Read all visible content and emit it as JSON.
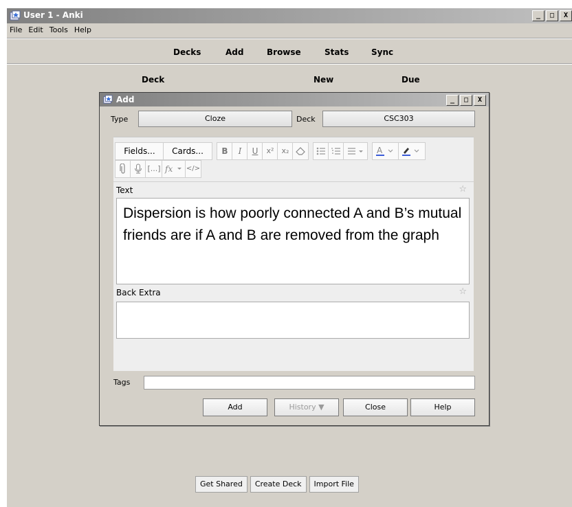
{
  "main_window": {
    "title": "User 1 - Anki",
    "menu": [
      "File",
      "Edit",
      "Tools",
      "Help"
    ],
    "toolbar": [
      "Decks",
      "Add",
      "Browse",
      "Stats",
      "Sync"
    ],
    "deck_header": {
      "deck": "Deck",
      "new": "New",
      "due": "Due"
    },
    "bottom_buttons": [
      "Get Shared",
      "Create Deck",
      "Import File"
    ],
    "window_buttons": {
      "minimize": "_",
      "maximize": "□",
      "close": "X"
    }
  },
  "add_dialog": {
    "title": "Add",
    "type_label": "Type",
    "type_value": "Cloze",
    "deck_label": "Deck",
    "deck_value": "CSC303",
    "editor_toolbar": {
      "fields": "Fields...",
      "cards": "Cards...",
      "bold": "B",
      "italic": "I",
      "underline": "U",
      "superscript": "x²",
      "subscript": "x₂",
      "cloze": "[...]",
      "html": "</>"
    },
    "fields": [
      {
        "name": "Text",
        "value": "Dispersion is how poorly connected A and B’s mutual friends are if A and B are removed from the graph"
      },
      {
        "name": "Back Extra",
        "value": ""
      }
    ],
    "tags_label": "Tags",
    "tags_value": "",
    "buttons": {
      "add": "Add",
      "history": "History ▼",
      "close": "Close",
      "help": "Help"
    }
  }
}
